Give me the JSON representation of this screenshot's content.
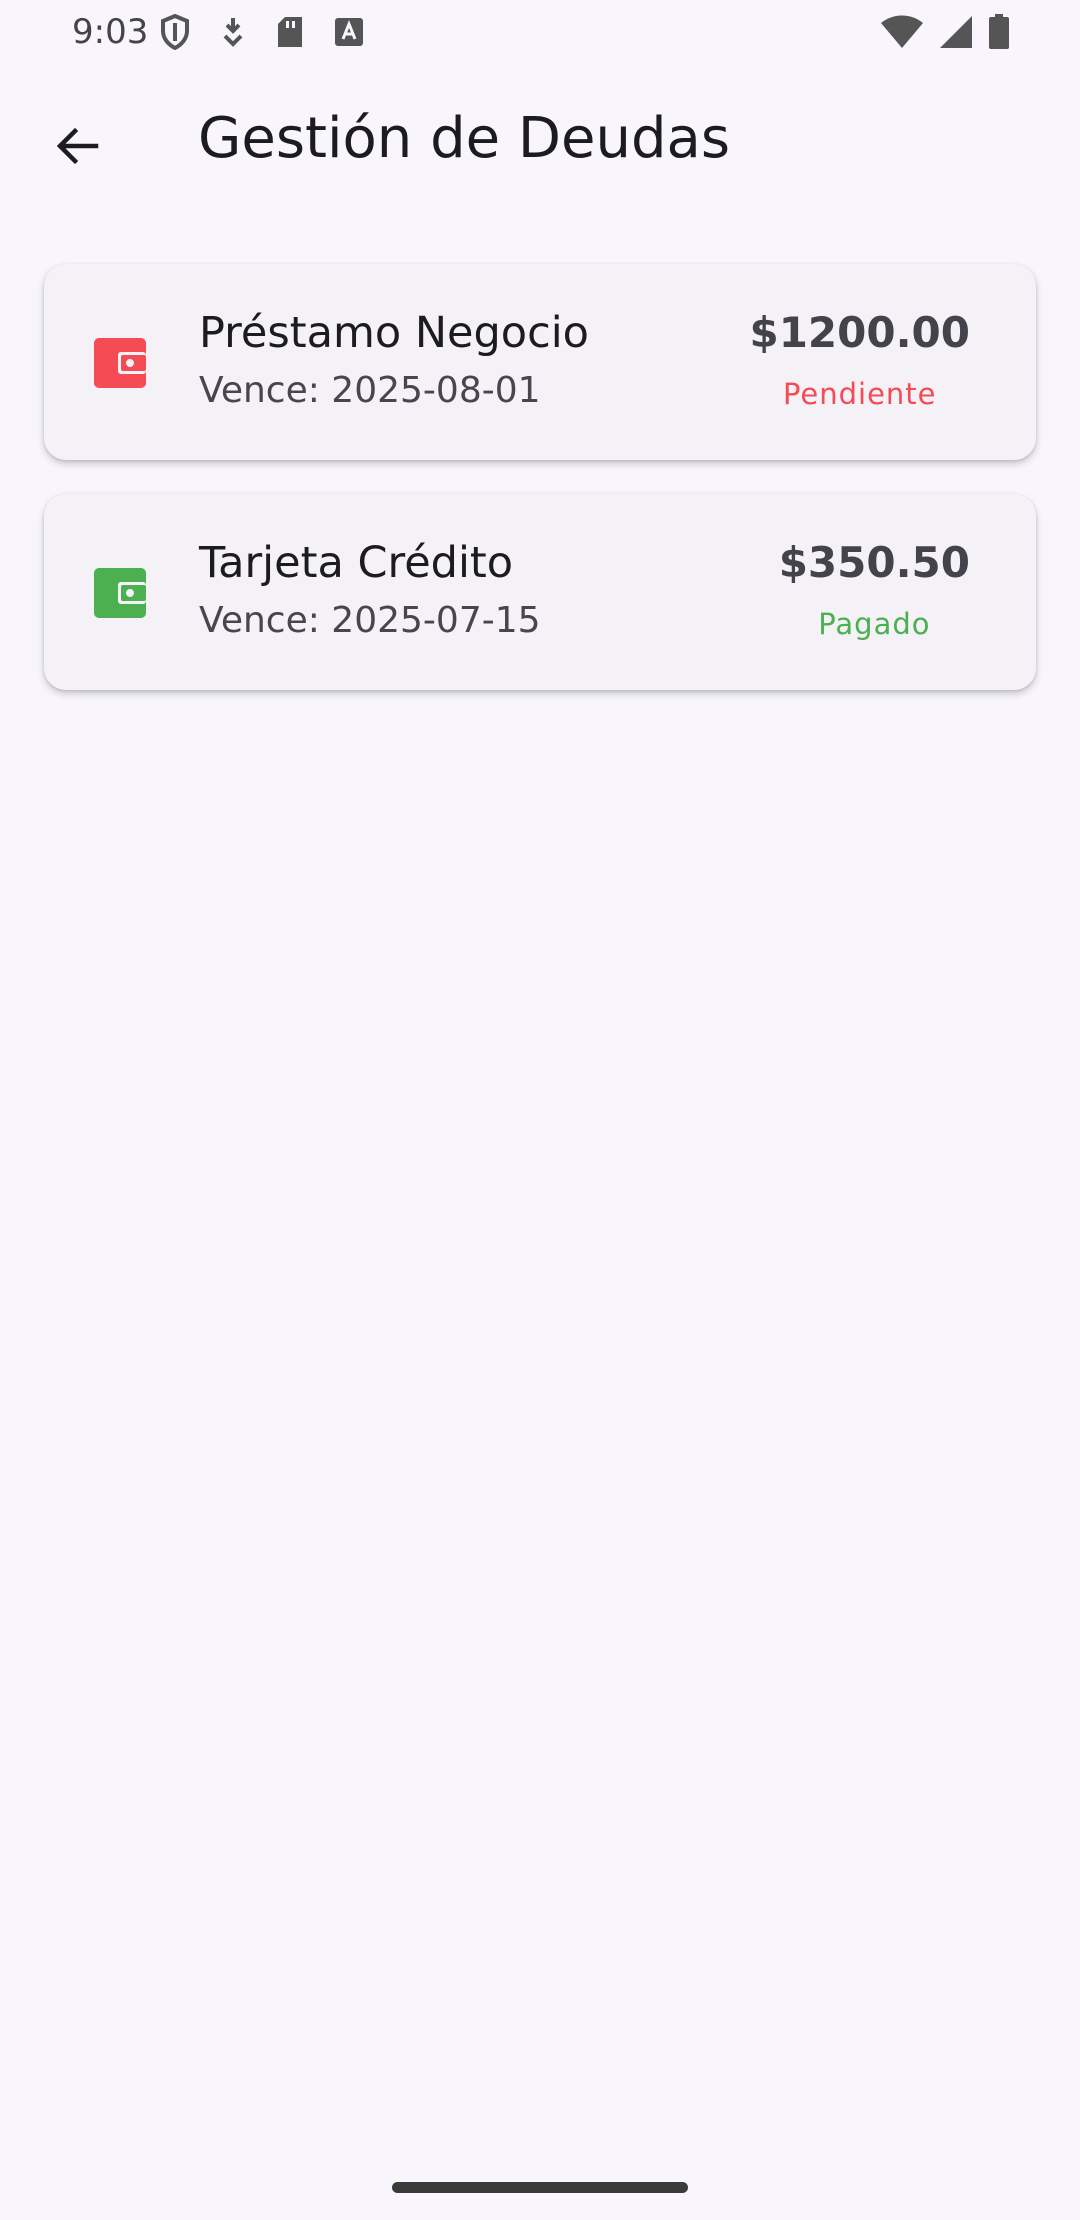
{
  "status_bar": {
    "time": "9:03",
    "left_icons": [
      "shield-icon",
      "download-icon",
      "sd-card-icon",
      "font-a-icon"
    ],
    "right_icons": [
      "wifi-icon",
      "cell-signal-icon",
      "battery-icon"
    ]
  },
  "app_bar": {
    "back_icon": "arrow-back-icon",
    "title": "Gestión de Deudas"
  },
  "debts": [
    {
      "name": "Préstamo Negocio",
      "due": "Vence: 2025-08-01",
      "amount": "$1200.00",
      "status": "Pendiente",
      "icon": "wallet-icon",
      "color": "#f44b55"
    },
    {
      "name": "Tarjeta Crédito",
      "due": "Vence: 2025-07-15",
      "amount": "$350.50",
      "status": "Pagado",
      "icon": "wallet-icon",
      "color": "#4caf50"
    }
  ],
  "colors": {
    "background": "#f8f5fd",
    "card": "#f4f1f7",
    "pending": "#f44b55",
    "paid": "#4caf50"
  }
}
